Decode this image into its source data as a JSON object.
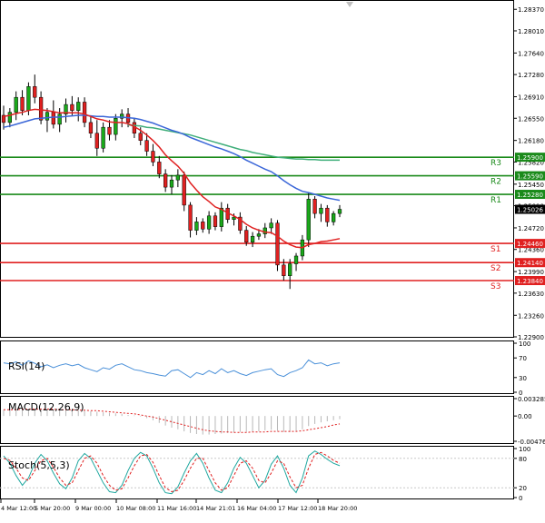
{
  "price_axis": {
    "ticks": [
      "1.28370",
      "1.28010",
      "1.27640",
      "1.27280",
      "1.26910",
      "1.26550",
      "1.26180",
      "1.25820",
      "1.25450",
      "1.25090",
      "1.24720",
      "1.24360",
      "1.23990",
      "1.23630",
      "1.23260",
      "1.22900"
    ],
    "current_price_label": "1.25026"
  },
  "levels": [
    {
      "name": "R3",
      "label": "R3",
      "value": 1.259,
      "value_label": "1.25900",
      "color": "#1a8a1a"
    },
    {
      "name": "R2",
      "label": "R2",
      "value": 1.2559,
      "value_label": "1.25590",
      "color": "#1a8a1a"
    },
    {
      "name": "R1",
      "label": "R1",
      "value": 1.2528,
      "value_label": "1.25280",
      "color": "#1a8a1a"
    },
    {
      "name": "S1",
      "label": "S1",
      "value": 1.2446,
      "value_label": "1.24460",
      "color": "#e02020"
    },
    {
      "name": "S2",
      "label": "S2",
      "value": 1.2414,
      "value_label": "1.24140",
      "color": "#e02020"
    },
    {
      "name": "S3",
      "label": "S3",
      "value": 1.2384,
      "value_label": "1.23840",
      "color": "#e02020"
    }
  ],
  "indicators": {
    "rsi": {
      "label": "RSI(14)",
      "ticks": [
        "100",
        "70",
        "30",
        "0"
      ]
    },
    "macd": {
      "label": "MACD(12,26,9)",
      "ticks": [
        "0.003285",
        "0.00",
        "-0.004769"
      ]
    },
    "stoch": {
      "label": "Stoch(5,5,3)",
      "ticks": [
        "100",
        "80",
        "20",
        "0"
      ]
    }
  },
  "time_axis": [
    "4 Mar 12:00",
    "5 Mar 20:00",
    "9 Mar 00:00",
    "10 Mar 08:00",
    "11 Mar 16:00",
    "14 Mar 21:01",
    "16 Mar 04:00",
    "17 Mar 12:00",
    "18 Mar 20:00"
  ],
  "colors": {
    "bull": "#1aa81a",
    "bear": "#e02020",
    "ma_fast": "#e02020",
    "ma_mid": "#3a66d8",
    "ma_slow": "#3fae7a",
    "rsi": "#4a90d9",
    "stoch_main": "#20a8a0",
    "stoch_signal": "#e02020",
    "macd_hist": "#b8b8b8",
    "macd_signal": "#e02020"
  },
  "chart_data": {
    "type": "candlestick",
    "ylim": [
      1.229,
      1.2851
    ],
    "candles": [
      [
        1.266,
        1.2676,
        1.2636,
        1.2648
      ],
      [
        1.2648,
        1.2672,
        1.264,
        1.2665
      ],
      [
        1.2665,
        1.27,
        1.2652,
        1.269
      ],
      [
        1.269,
        1.2702,
        1.266,
        1.2668
      ],
      [
        1.2668,
        1.2715,
        1.266,
        1.2708
      ],
      [
        1.2708,
        1.2728,
        1.268,
        1.269
      ],
      [
        1.269,
        1.27,
        1.2645,
        1.2652
      ],
      [
        1.2652,
        1.2672,
        1.2632,
        1.2665
      ],
      [
        1.2665,
        1.2685,
        1.2638,
        1.2645
      ],
      [
        1.2645,
        1.2672,
        1.2632,
        1.2662
      ],
      [
        1.2662,
        1.2688,
        1.2648,
        1.2678
      ],
      [
        1.2678,
        1.2692,
        1.266,
        1.2668
      ],
      [
        1.2668,
        1.269,
        1.265,
        1.2682
      ],
      [
        1.2682,
        1.269,
        1.264,
        1.2648
      ],
      [
        1.2648,
        1.266,
        1.2622,
        1.263
      ],
      [
        1.263,
        1.2652,
        1.2592,
        1.2605
      ],
      [
        1.2605,
        1.2648,
        1.2598,
        1.264
      ],
      [
        1.264,
        1.2652,
        1.2618,
        1.2628
      ],
      [
        1.2628,
        1.2662,
        1.2618,
        1.2655
      ],
      [
        1.2655,
        1.267,
        1.264,
        1.2662
      ],
      [
        1.2662,
        1.2672,
        1.264,
        1.2648
      ],
      [
        1.2648,
        1.2655,
        1.2622,
        1.263
      ],
      [
        1.263,
        1.264,
        1.261,
        1.2618
      ],
      [
        1.2618,
        1.263,
        1.2592,
        1.26
      ],
      [
        1.26,
        1.2612,
        1.2575,
        1.2582
      ],
      [
        1.2582,
        1.2592,
        1.2555,
        1.2562
      ],
      [
        1.2562,
        1.257,
        1.2532,
        1.254
      ],
      [
        1.254,
        1.256,
        1.2528,
        1.2552
      ],
      [
        1.2552,
        1.257,
        1.254,
        1.256
      ],
      [
        1.256,
        1.2566,
        1.25,
        1.251
      ],
      [
        1.251,
        1.2515,
        1.2456,
        1.2468
      ],
      [
        1.2468,
        1.249,
        1.246,
        1.2482
      ],
      [
        1.2482,
        1.2488,
        1.2464,
        1.247
      ],
      [
        1.247,
        1.25,
        1.2462,
        1.2492
      ],
      [
        1.2492,
        1.2498,
        1.2468,
        1.2474
      ],
      [
        1.2474,
        1.2515,
        1.2466,
        1.2505
      ],
      [
        1.2505,
        1.2512,
        1.248,
        1.2486
      ],
      [
        1.2486,
        1.2496,
        1.2476,
        1.249
      ],
      [
        1.249,
        1.2498,
        1.2462,
        1.2468
      ],
      [
        1.2468,
        1.2475,
        1.2442,
        1.2448
      ],
      [
        1.2448,
        1.2465,
        1.244,
        1.2458
      ],
      [
        1.2458,
        1.247,
        1.2452,
        1.2462
      ],
      [
        1.2462,
        1.248,
        1.2455,
        1.2472
      ],
      [
        1.2472,
        1.2488,
        1.2462,
        1.248
      ],
      [
        1.248,
        1.2485,
        1.24,
        1.241
      ],
      [
        1.241,
        1.242,
        1.2384,
        1.2392
      ],
      [
        1.2392,
        1.242,
        1.237,
        1.2412
      ],
      [
        1.2412,
        1.243,
        1.24,
        1.2425
      ],
      [
        1.2425,
        1.246,
        1.2418,
        1.2452
      ],
      [
        1.2452,
        1.253,
        1.244,
        1.252
      ],
      [
        1.252,
        1.2525,
        1.2488,
        1.2496
      ],
      [
        1.2496,
        1.2512,
        1.2482,
        1.2505
      ],
      [
        1.2505,
        1.251,
        1.2474,
        1.2482
      ],
      [
        1.2482,
        1.25,
        1.2476,
        1.2496
      ],
      [
        1.2496,
        1.251,
        1.249,
        1.2503
      ]
    ],
    "ma_fast": [
      1.2658,
      1.266,
      1.2663,
      1.2665,
      1.2668,
      1.267,
      1.2669,
      1.2668,
      1.2666,
      1.2664,
      1.2664,
      1.2664,
      1.2664,
      1.2662,
      1.2658,
      1.2654,
      1.2652,
      1.2649,
      1.2648,
      1.2648,
      1.2646,
      1.2641,
      1.2635,
      1.2627,
      1.2618,
      1.2607,
      1.2594,
      1.2584,
      1.2575,
      1.2563,
      1.2547,
      1.2535,
      1.2524,
      1.2516,
      1.2507,
      1.2503,
      1.2497,
      1.2492,
      1.2486,
      1.2478,
      1.2472,
      1.2468,
      1.2465,
      1.2464,
      1.2458,
      1.245,
      1.2444,
      1.244,
      1.2439,
      1.2444,
      1.2446,
      1.2449,
      1.245,
      1.2452,
      1.2454
    ],
    "ma_mid": [
      1.264,
      1.2642,
      1.2645,
      1.2648,
      1.2651,
      1.2654,
      1.2655,
      1.2656,
      1.2657,
      1.2657,
      1.2658,
      1.2659,
      1.266,
      1.266,
      1.2659,
      1.2658,
      1.2658,
      1.2657,
      1.2657,
      1.2657,
      1.2656,
      1.2655,
      1.2653,
      1.265,
      1.2647,
      1.2643,
      1.2639,
      1.2635,
      1.2632,
      1.2628,
      1.2623,
      1.2619,
      1.2615,
      1.2611,
      1.2607,
      1.2604,
      1.26,
      1.2596,
      1.2591,
      1.2585,
      1.258,
      1.2575,
      1.257,
      1.2566,
      1.2559,
      1.2551,
      1.2544,
      1.2538,
      1.2533,
      1.2531,
      1.2528,
      1.2525,
      1.2522,
      1.252,
      1.2518
    ],
    "ma_slow_start": 20,
    "ma_slow": [
      1.2644,
      1.2643,
      1.2642,
      1.264,
      1.2639,
      1.2637,
      1.2635,
      1.2633,
      1.2631,
      1.2629,
      1.2627,
      1.2624,
      1.2621,
      1.2618,
      1.2615,
      1.2612,
      1.2609,
      1.2606,
      1.2603,
      1.2601,
      1.2598,
      1.2596,
      1.2594,
      1.2592,
      1.259,
      1.2589,
      1.2588,
      1.2587,
      1.2587,
      1.2586,
      1.2586,
      1.2585,
      1.2585,
      1.2585,
      1.2585
    ],
    "rsi": [
      60,
      58,
      62,
      55,
      64,
      59,
      52,
      56,
      50,
      55,
      58,
      54,
      57,
      50,
      46,
      42,
      50,
      47,
      55,
      58,
      52,
      46,
      44,
      40,
      38,
      35,
      33,
      44,
      46,
      38,
      30,
      40,
      36,
      44,
      38,
      48,
      40,
      44,
      38,
      34,
      40,
      43,
      46,
      48,
      36,
      32,
      40,
      44,
      50,
      66,
      58,
      60,
      54,
      58,
      60
    ],
    "macd_hist": [
      0.0012,
      0.0012,
      0.0013,
      0.0013,
      0.0014,
      0.0014,
      0.0013,
      0.0013,
      0.0012,
      0.0012,
      0.0011,
      0.0011,
      0.0011,
      0.001,
      0.0009,
      0.0008,
      0.0007,
      0.0006,
      0.0005,
      0.0004,
      0.0002,
      0.0001,
      -0.0001,
      -0.0004,
      -0.0008,
      -0.0013,
      -0.0018,
      -0.0022,
      -0.0025,
      -0.0029,
      -0.0032,
      -0.0034,
      -0.0035,
      -0.0035,
      -0.0034,
      -0.0033,
      -0.0032,
      -0.0031,
      -0.003,
      -0.003,
      -0.0029,
      -0.0029,
      -0.0027,
      -0.0026,
      -0.0028,
      -0.003,
      -0.003,
      -0.0028,
      -0.0025,
      -0.0019,
      -0.0015,
      -0.0012,
      -0.001,
      -0.0008,
      -0.0006
    ],
    "macd_signal": [
      0.0012,
      0.0012,
      0.0012,
      0.0013,
      0.0013,
      0.0013,
      0.0013,
      0.0013,
      0.0013,
      0.0012,
      0.0012,
      0.0012,
      0.0011,
      0.0011,
      0.001,
      0.001,
      0.0009,
      0.0008,
      0.0007,
      0.0006,
      0.0005,
      0.0004,
      0.0002,
      0.0,
      -0.0002,
      -0.0005,
      -0.0008,
      -0.0011,
      -0.0014,
      -0.0017,
      -0.002,
      -0.0023,
      -0.0026,
      -0.0028,
      -0.0029,
      -0.003,
      -0.003,
      -0.0031,
      -0.0031,
      -0.0031,
      -0.003,
      -0.003,
      -0.003,
      -0.0029,
      -0.0029,
      -0.0029,
      -0.0029,
      -0.0029,
      -0.0028,
      -0.0026,
      -0.0024,
      -0.0022,
      -0.002,
      -0.0017,
      -0.0015
    ],
    "stoch_k": [
      85,
      70,
      45,
      25,
      40,
      70,
      88,
      75,
      50,
      28,
      18,
      40,
      75,
      90,
      80,
      55,
      30,
      12,
      10,
      25,
      55,
      80,
      92,
      85,
      60,
      30,
      10,
      8,
      22,
      50,
      75,
      90,
      70,
      40,
      15,
      10,
      30,
      60,
      82,
      70,
      45,
      20,
      35,
      68,
      85,
      60,
      25,
      10,
      40,
      85,
      95,
      88,
      78,
      70,
      65
    ],
    "stoch_d": [
      80,
      76,
      60,
      40,
      35,
      55,
      75,
      80,
      62,
      40,
      25,
      30,
      55,
      80,
      85,
      70,
      45,
      25,
      15,
      18,
      40,
      65,
      85,
      88,
      72,
      45,
      20,
      12,
      15,
      35,
      60,
      80,
      80,
      55,
      30,
      15,
      20,
      45,
      70,
      75,
      60,
      35,
      30,
      50,
      75,
      70,
      42,
      20,
      25,
      60,
      88,
      92,
      85,
      76,
      70
    ]
  }
}
